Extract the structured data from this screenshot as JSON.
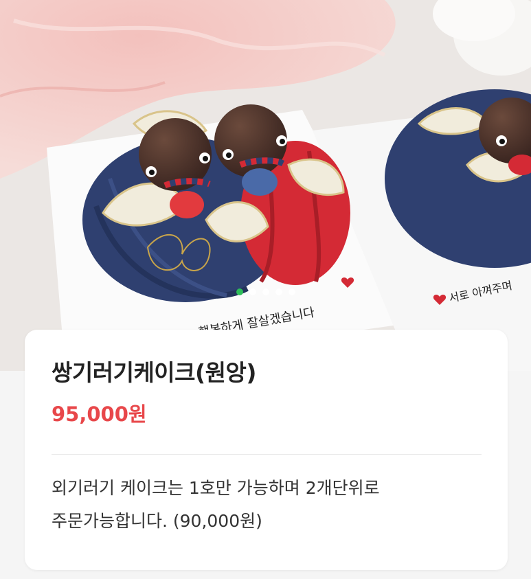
{
  "product": {
    "title": "쌍기러기케이크(원앙)",
    "price": "95,000원",
    "description_line1": "외기러기 케이크는 1호만 가능하며 2개단위로",
    "description_line2": "주문가능합니다. (90,000원)"
  },
  "gallery": {
    "slide_count": 5,
    "active_index": 0,
    "card_text_left": "행복하게 잘살겠습니다",
    "card_text_right": "서로 아껴주며"
  },
  "colors": {
    "price": "#e8474a",
    "active_dot": "#2ebd59",
    "navy": "#2f4070",
    "red": "#d42a35"
  }
}
